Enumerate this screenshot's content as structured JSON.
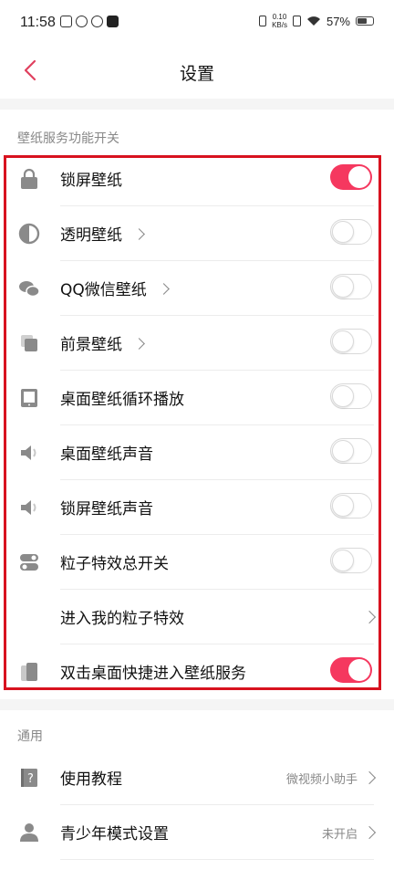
{
  "status_bar": {
    "time": "11:58",
    "net_speed_value": "0.10",
    "net_speed_unit": "KB/s",
    "battery": "57%"
  },
  "header": {
    "title": "设置"
  },
  "wallpaper_section": {
    "label": "壁纸服务功能开关",
    "rows": [
      {
        "label": "锁屏壁纸",
        "icon": "lock-icon",
        "has_arrow": false,
        "toggle": true
      },
      {
        "label": "透明壁纸",
        "icon": "half-circle-icon",
        "has_arrow": true,
        "toggle": false
      },
      {
        "label": "QQ微信壁纸",
        "icon": "chat-bubbles-icon",
        "has_arrow": true,
        "toggle": false
      },
      {
        "label": "前景壁纸",
        "icon": "layers-icon",
        "has_arrow": true,
        "toggle": false
      },
      {
        "label": "桌面壁纸循环播放",
        "icon": "tablet-icon",
        "has_arrow": false,
        "toggle": false
      },
      {
        "label": "桌面壁纸声音",
        "icon": "speaker-icon",
        "has_arrow": false,
        "toggle": false
      },
      {
        "label": "锁屏壁纸声音",
        "icon": "speaker-icon",
        "has_arrow": false,
        "toggle": false
      },
      {
        "label": "粒子特效总开关",
        "icon": "switches-icon",
        "has_arrow": false,
        "toggle": false
      },
      {
        "label": "进入我的粒子特效",
        "icon": "",
        "has_arrow": false,
        "toggle": null
      },
      {
        "label": "双击桌面快捷进入壁纸服务",
        "icon": "phones-icon",
        "has_arrow": false,
        "toggle": true
      }
    ]
  },
  "general_section": {
    "label": "通用",
    "rows": [
      {
        "label": "使用教程",
        "icon": "help-book-icon",
        "value": "微视频小助手"
      },
      {
        "label": "青少年模式设置",
        "icon": "user-icon",
        "value": "未开启"
      }
    ]
  },
  "colors": {
    "accent": "#f5385f",
    "highlight_border": "#d8121f",
    "back_arrow": "#e0405e"
  }
}
